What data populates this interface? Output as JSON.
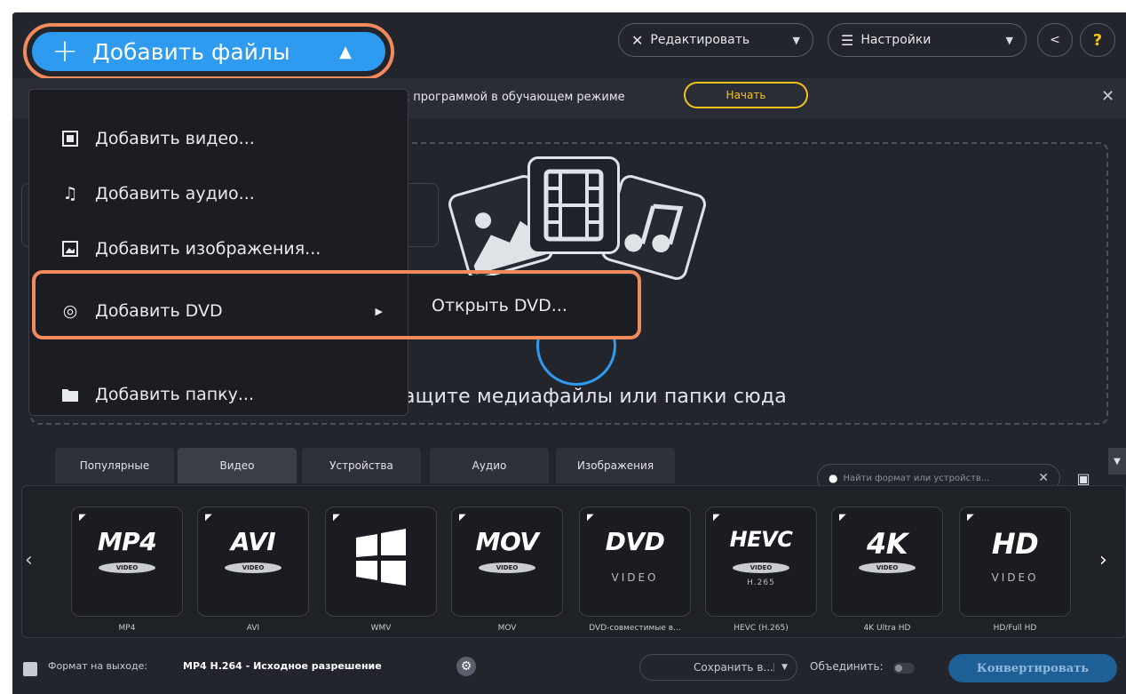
{
  "toolbar": {
    "add_files_label": "Добавить файлы",
    "edit_label": "Редактировать",
    "settings_label": "Настройки",
    "help_label": "?"
  },
  "banner": {
    "text": "с программой в обучающем режиме",
    "start_label": "Начать"
  },
  "add_menu": {
    "items": [
      {
        "label": "Добавить видео...",
        "icon": "video-frame-icon"
      },
      {
        "label": "Добавить аудио...",
        "icon": "music-note-icon"
      },
      {
        "label": "Добавить изображения...",
        "icon": "image-icon"
      },
      {
        "label": "Добавить DVD",
        "icon": "disc-icon"
      },
      {
        "label": "Добавить папку...",
        "icon": "folder-icon"
      }
    ],
    "dvd_submenu": {
      "label": "Открыть DVD..."
    }
  },
  "dropzone": {
    "text": "ащите медиафайлы или папки сюда"
  },
  "tabs": [
    {
      "label": "Популярные",
      "active": false
    },
    {
      "label": "Видео",
      "active": true
    },
    {
      "label": "Устройства",
      "active": false
    },
    {
      "label": "Аудио",
      "active": false
    },
    {
      "label": "Изображения",
      "active": false
    }
  ],
  "search": {
    "placeholder": "Найти формат или устройств..."
  },
  "formats": [
    {
      "logo": "MP4",
      "badge": "VIDEO",
      "sub": "",
      "label": "MP4"
    },
    {
      "logo": "AVI",
      "badge": "VIDEO",
      "sub": "",
      "label": "AVI"
    },
    {
      "logo": "",
      "badge": "",
      "sub": "",
      "label": "WMV"
    },
    {
      "logo": "MOV",
      "badge": "VIDEO",
      "sub": "",
      "label": "MOV"
    },
    {
      "logo": "DVD",
      "badge": "",
      "sub": "VIDEO",
      "label": "DVD-совместимые в..."
    },
    {
      "logo": "HEVC",
      "badge": "VIDEO",
      "sub": "H.265",
      "label": "HEVC (H.265)"
    },
    {
      "logo": "4K",
      "badge": "VIDEO",
      "sub": "",
      "label": "4K Ultra HD"
    },
    {
      "logo": "HD",
      "badge": "",
      "sub": "VIDEO",
      "label": "HD/Full HD"
    }
  ],
  "bottom": {
    "output_label": "Формат на выходе:",
    "output_value": "MP4 H.264 - Исходное разрешение",
    "save_label": "Сохранить в...",
    "merge_label": "Объединить:",
    "convert_label": "Конвертировать"
  },
  "colors": {
    "accent": "#2e9bf0",
    "highlight": "#f28a5d",
    "start_button": "#f3c318",
    "background": "#22252c"
  }
}
